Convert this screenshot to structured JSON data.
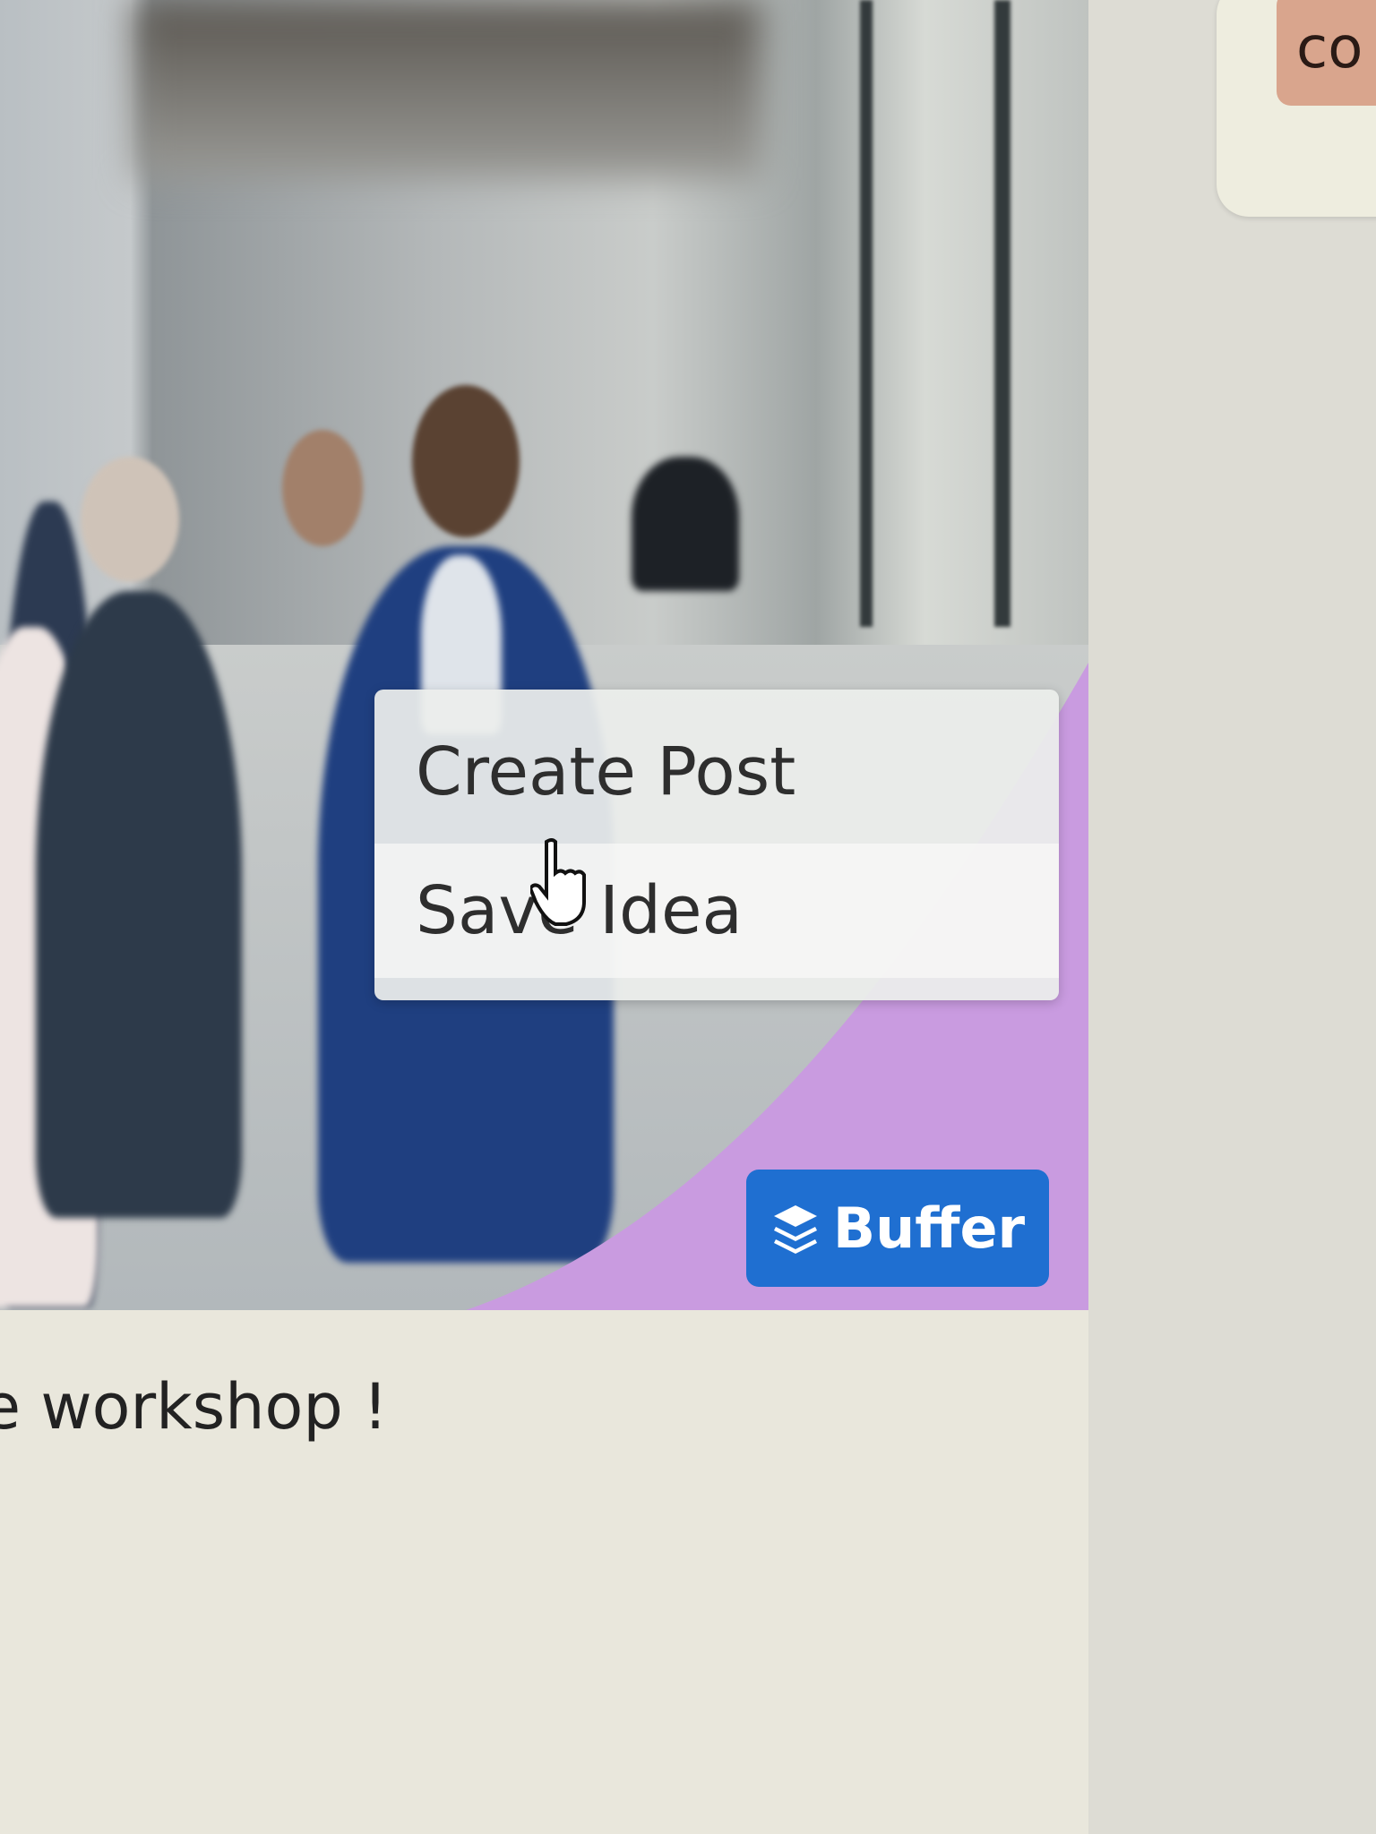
{
  "right_panel": {
    "button_label": "co"
  },
  "context_menu": {
    "items": [
      {
        "label": "Create Post"
      },
      {
        "label": "Save Idea"
      }
    ]
  },
  "buffer_button": {
    "label": "Buffer",
    "icon": "buffer-layers-icon",
    "color": "#1f6fd1"
  },
  "post": {
    "caption": "e workshop !"
  },
  "colors": {
    "accent_purple": "#c99be0",
    "card_button": "#d9a58d"
  }
}
